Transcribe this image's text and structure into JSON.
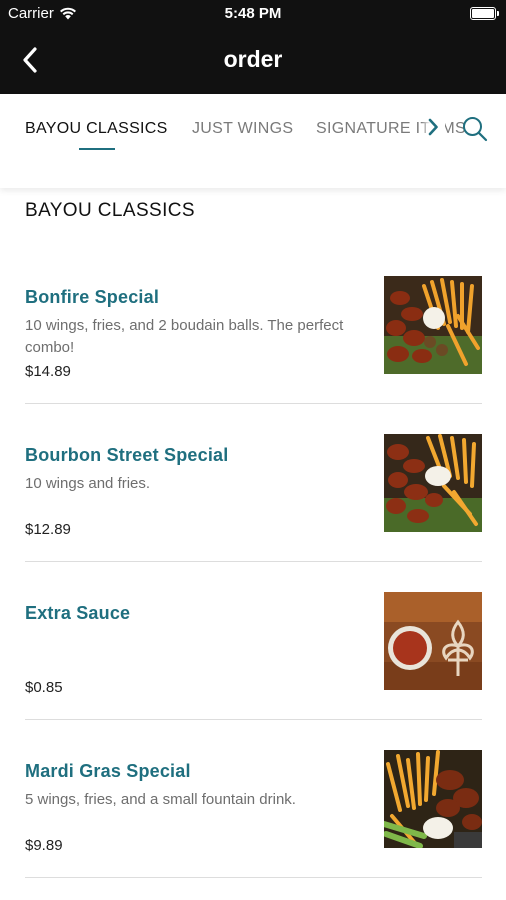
{
  "status_bar": {
    "carrier": "Carrier",
    "time": "5:48 PM"
  },
  "nav": {
    "title": "order",
    "back_icon": "chevron-left-icon"
  },
  "tabs": [
    {
      "label": "BAYOU CLASSICS",
      "active": true
    },
    {
      "label": "JUST WINGS",
      "active": false
    },
    {
      "label": "SIGNATURE ITEMS",
      "active": false
    }
  ],
  "section": {
    "title": "BAYOU CLASSICS"
  },
  "menu_items": [
    {
      "name": "Bonfire Special",
      "description": "10 wings, fries, and 2 boudain balls. The perfect combo!",
      "price": "$14.89",
      "image": "wings-fries-boudain-photo"
    },
    {
      "name": "Bourbon Street Special",
      "description": "10 wings and fries.",
      "price": "$12.89",
      "image": "wings-fries-photo"
    },
    {
      "name": "Extra Sauce",
      "description": "",
      "price": "$0.85",
      "image": "sauce-cup-fleur-de-lis-photo"
    },
    {
      "name": "Mardi Gras Special",
      "description": "5 wings, fries, and a small fountain drink.",
      "price": "$9.89",
      "image": "wings-fries-celery-photo"
    }
  ],
  "colors": {
    "header_bg": "#111111",
    "accent": "#1f6f7f",
    "text_secondary": "#6e6e6e"
  }
}
